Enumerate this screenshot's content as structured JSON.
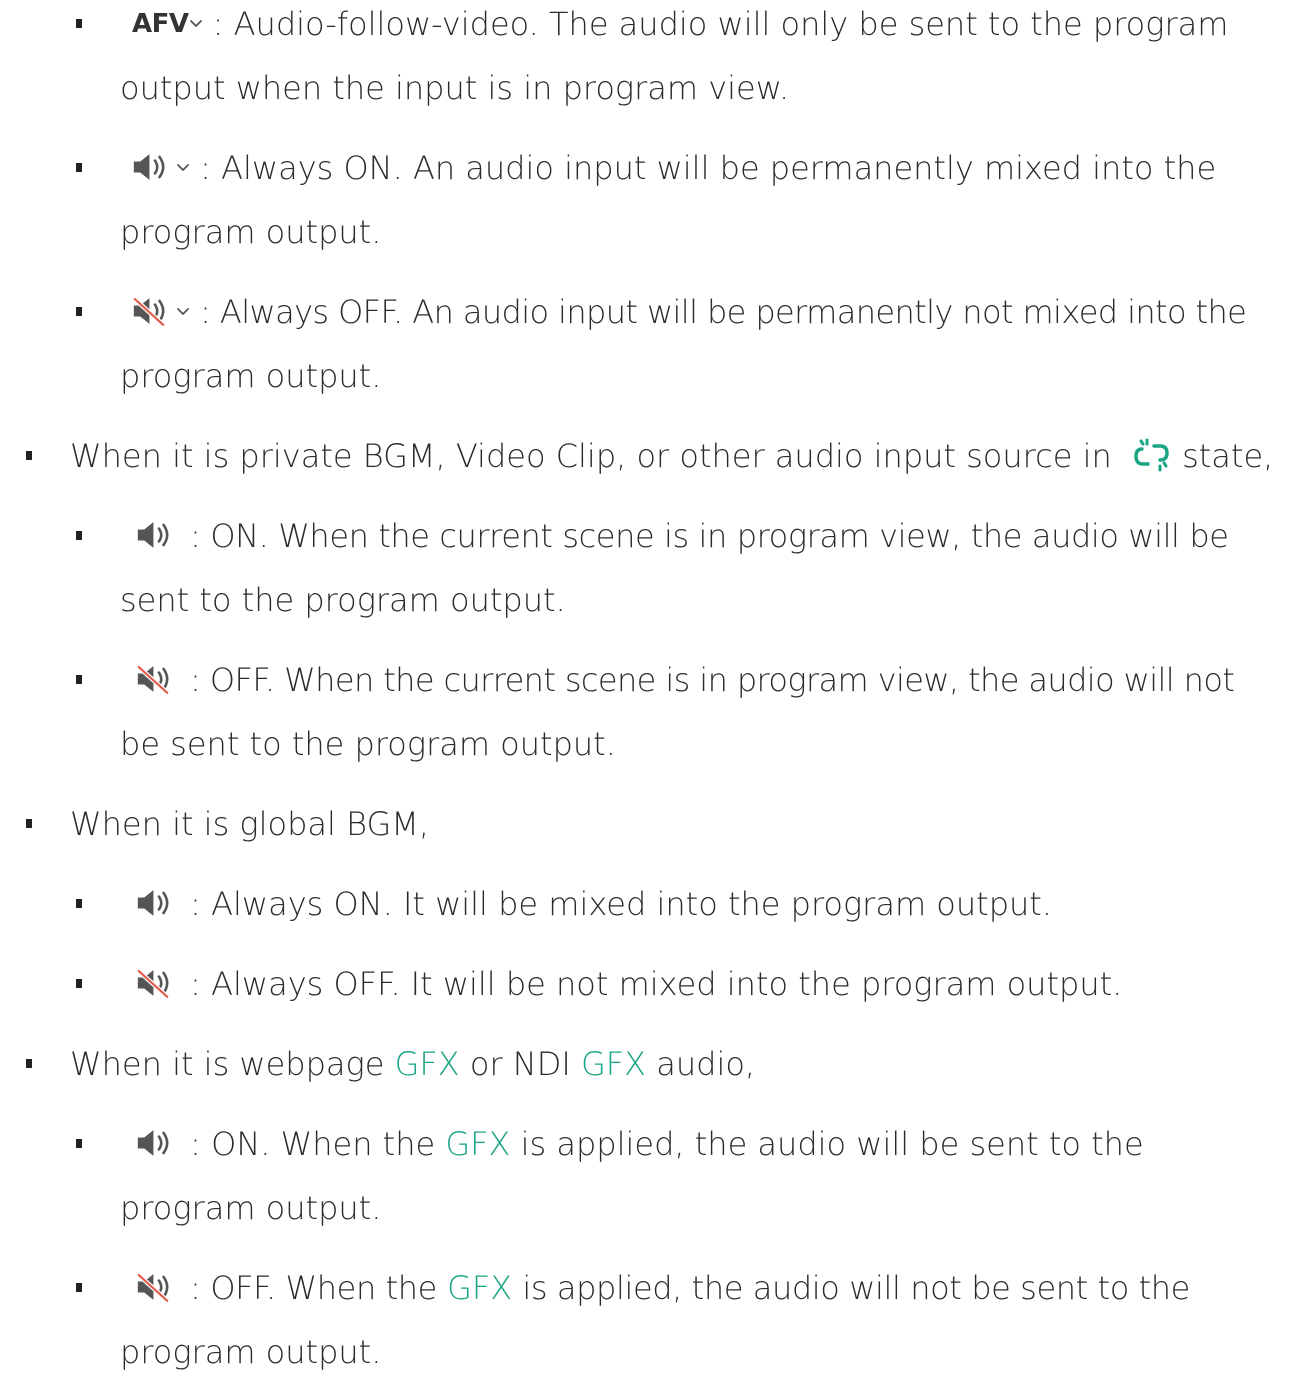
{
  "icons": {
    "afv": "AFV",
    "chevron": "chevron-down-icon",
    "speaker_on": "speaker-on-icon",
    "speaker_off": "speaker-muted-icon",
    "unlink": "unlink-icon"
  },
  "colors": {
    "link_green": "#1aa584",
    "muted_red": "#e0604f"
  },
  "items": {
    "afv_text_1": ": Audio-follow-video. The audio will only be sent to the program",
    "afv_text_2": "output when the input is in program view.",
    "on_text_1": ": Always ON. An audio input will be permanently mixed into the",
    "on_text_2": "program output.",
    "off_text_1": ": Always OFF. An audio input will be permanently not mixed into the",
    "off_text_2": "program output.",
    "private_intro_a": "When it is private BGM, Video Clip, or other audio input source in",
    "private_intro_b": "state,",
    "private_on_1": ": ON. When the current scene is in program view, the audio will be",
    "private_on_2": "sent to the program output.",
    "private_off_1": ": OFF. When the current scene is in program view, the audio will not",
    "private_off_2": "be sent to the program output.",
    "global_intro": "When it is global BGM,",
    "global_on": ": Always ON. It will be mixed into the program output.",
    "global_off": ": Always OFF. It will be not mixed into the program output.",
    "gfx_intro_a": "When it is webpage",
    "gfx_word": "GFX",
    "gfx_intro_b": "or NDI",
    "gfx_intro_c": "audio,",
    "gfx_on_a": ": ON. When the",
    "gfx_on_b": "is applied, the audio will be sent to the",
    "gfx_on_2": "program output.",
    "gfx_off_a": ": OFF. When the",
    "gfx_off_b": "is applied, the audio will not be sent to the",
    "gfx_off_2": "program output."
  }
}
